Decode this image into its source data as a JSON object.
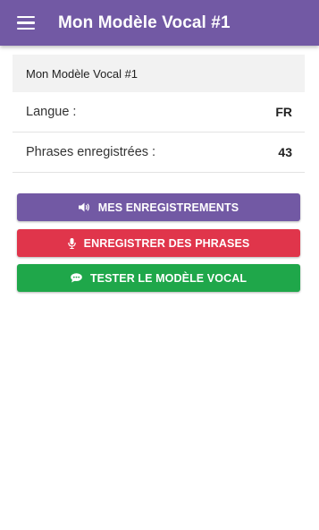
{
  "appbar": {
    "title": "Mon Modèle Vocal #1",
    "menu_icon": "hamburger-menu-icon"
  },
  "model_card": {
    "header": "Mon Modèle Vocal #1",
    "rows": [
      {
        "label": "Langue :",
        "value": "FR"
      },
      {
        "label": "Phrases enregistrées :",
        "value": "43"
      }
    ]
  },
  "buttons": [
    {
      "label": "MES ENREGISTREMENTS",
      "icon": "speaker-icon",
      "color": "#7259a4"
    },
    {
      "label": "ENREGISTRER DES PHRASES",
      "icon": "microphone-icon",
      "color": "#e0354b"
    },
    {
      "label": "TESTER LE MODÈLE VOCAL",
      "icon": "chat-bubble-icon",
      "color": "#1fa74a"
    }
  ],
  "colors": {
    "primary": "#7259a4",
    "danger": "#e0354b",
    "success": "#1fa74a"
  }
}
